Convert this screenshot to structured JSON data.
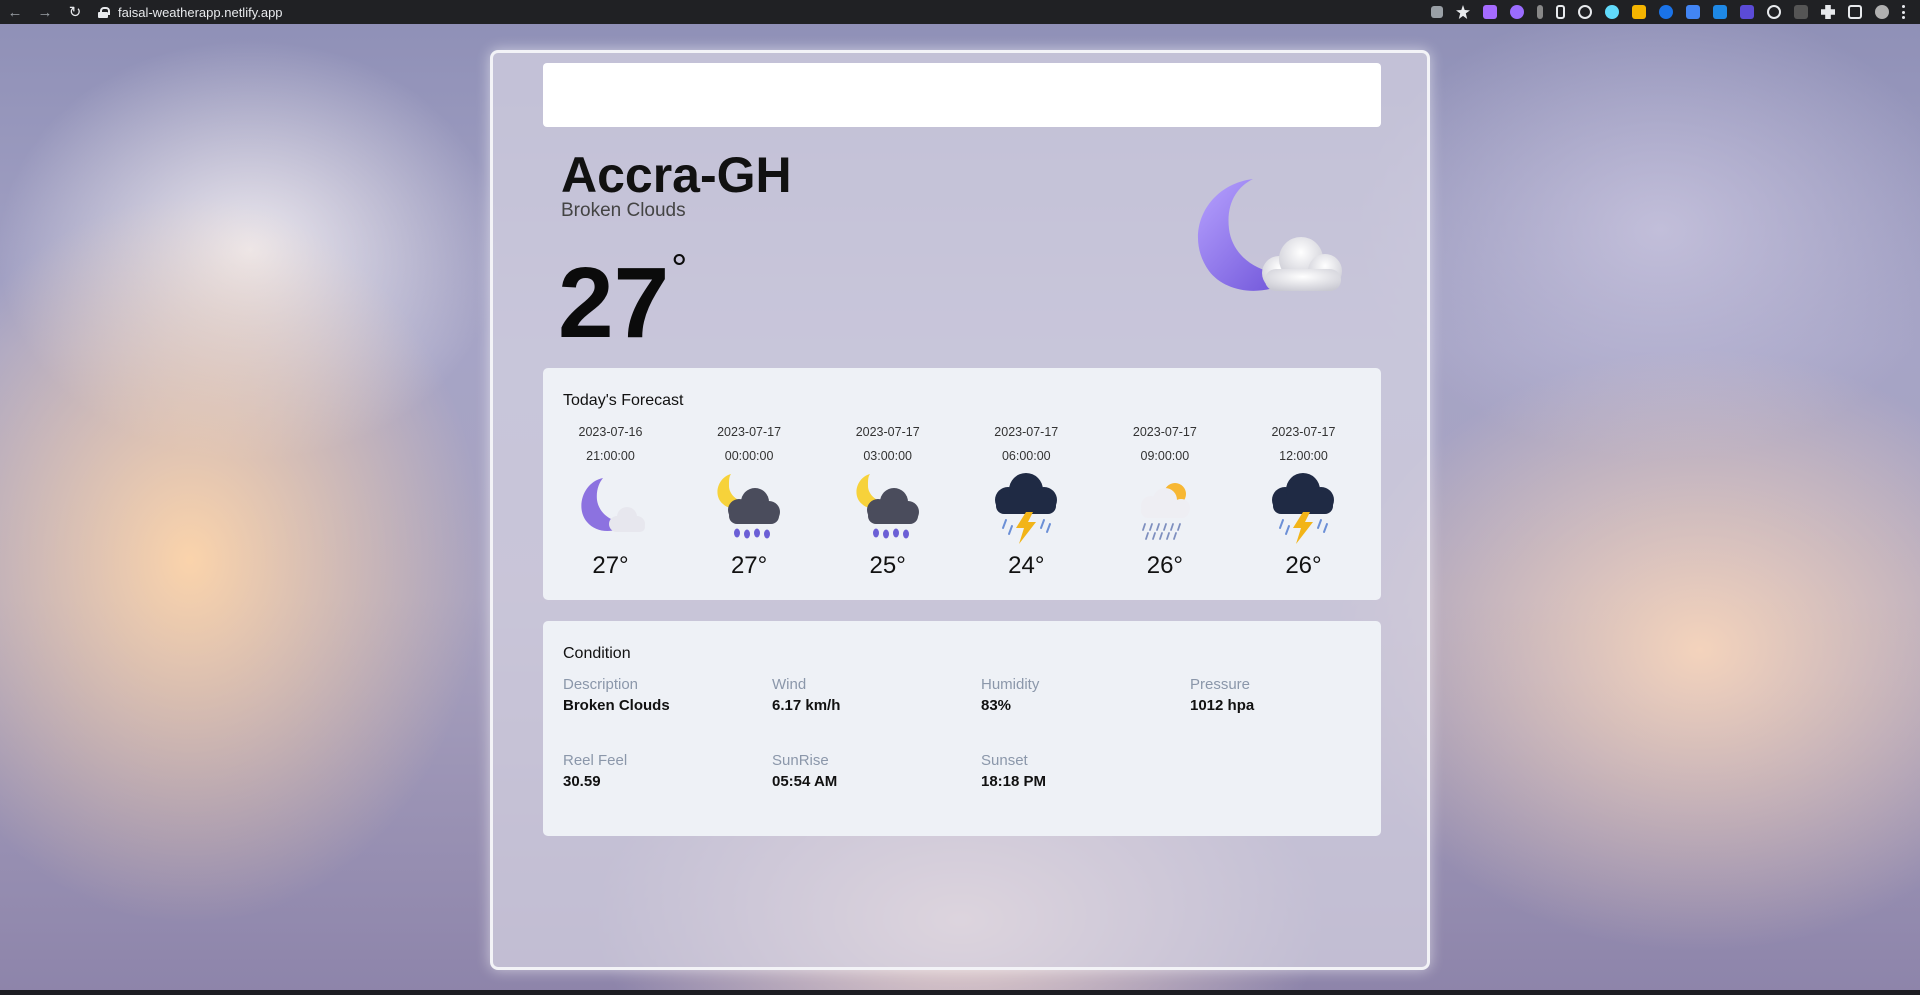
{
  "browser": {
    "url": "faisal-weatherapp.netlify.app"
  },
  "search": {
    "value": "",
    "placeholder": ""
  },
  "current": {
    "city": "Accra-GH",
    "description": "Broken Clouds",
    "temperature": "27",
    "degree_symbol": "°",
    "icon": "moon-cloud-icon"
  },
  "forecast": {
    "title": "Today's Forecast",
    "items": [
      {
        "date": "2023-07-16",
        "time": "21:00:00",
        "temp": "27°",
        "icon": "moon-cloud-icon"
      },
      {
        "date": "2023-07-17",
        "time": "00:00:00",
        "temp": "27°",
        "icon": "moon-rain-cloud-icon"
      },
      {
        "date": "2023-07-17",
        "time": "03:00:00",
        "temp": "25°",
        "icon": "moon-rain-cloud-icon"
      },
      {
        "date": "2023-07-17",
        "time": "06:00:00",
        "temp": "24°",
        "icon": "thunderstorm-icon"
      },
      {
        "date": "2023-07-17",
        "time": "09:00:00",
        "temp": "26°",
        "icon": "sun-rain-cloud-icon"
      },
      {
        "date": "2023-07-17",
        "time": "12:00:00",
        "temp": "26°",
        "icon": "thunderstorm-icon"
      }
    ]
  },
  "condition": {
    "title": "Condition",
    "fields": [
      {
        "label": "Description",
        "value": "Broken Clouds"
      },
      {
        "label": "Wind",
        "value": "6.17 km/h"
      },
      {
        "label": "Humidity",
        "value": "83%"
      },
      {
        "label": "Pressure",
        "value": "1012 hpa"
      },
      {
        "label": "Reel Feel",
        "value": "30.59"
      },
      {
        "label": "SunRise",
        "value": "05:54 AM"
      },
      {
        "label": "Sunset",
        "value": "18:18 PM"
      }
    ]
  },
  "colors": {
    "moon": "#8c72e0",
    "cloud_light": "#f1f1f4",
    "cloud_dark": "#3d3f4f",
    "storm_cloud": "#1f2a44",
    "rain": "#6b5fd6",
    "sun": "#f7d23a",
    "lightning": "#f2b418"
  }
}
